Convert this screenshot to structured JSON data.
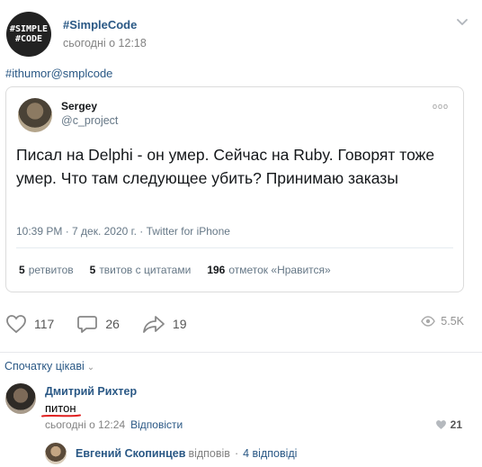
{
  "post": {
    "group_avatar_line1": "#SIMPLE",
    "group_avatar_line2": "#CODE",
    "group_name": "#SimpleCode",
    "time": "сьогодні о 12:18",
    "hashtag": "#ithumor@smplcode"
  },
  "tweet": {
    "author_name": "Sergey",
    "author_handle": "@c_project",
    "logo_text": "ooo",
    "text": "Писал на Delphi - он умер. Сейчас на Ruby. Говорят тоже умер. Что там следующее убить? Принимаю заказы",
    "meta": "10:39 PM · 7 дек. 2020 г. · Twitter for iPhone",
    "stats": [
      {
        "count": "5",
        "label": "ретвитов"
      },
      {
        "count": "5",
        "label": "твитов с цитатами"
      },
      {
        "count": "196",
        "label": "отметок «Нравится»"
      }
    ]
  },
  "actions": {
    "likes": "117",
    "comments": "26",
    "shares": "19",
    "views": "5.5K"
  },
  "comments_section": {
    "sort_label": "Спочатку цікаві",
    "comment": {
      "author": "Дмитрий Рихтер",
      "text": "питон",
      "time": "сьогодні о 12:24",
      "reply_label": "Відповісти",
      "likes": "21"
    },
    "reply_summary": {
      "author": "Евгений Скопинцев",
      "verb": "відповів",
      "count": "4 відповіді"
    }
  },
  "colors": {
    "link": "#2a5885",
    "muted": "#828282",
    "underline": "#e02020"
  }
}
